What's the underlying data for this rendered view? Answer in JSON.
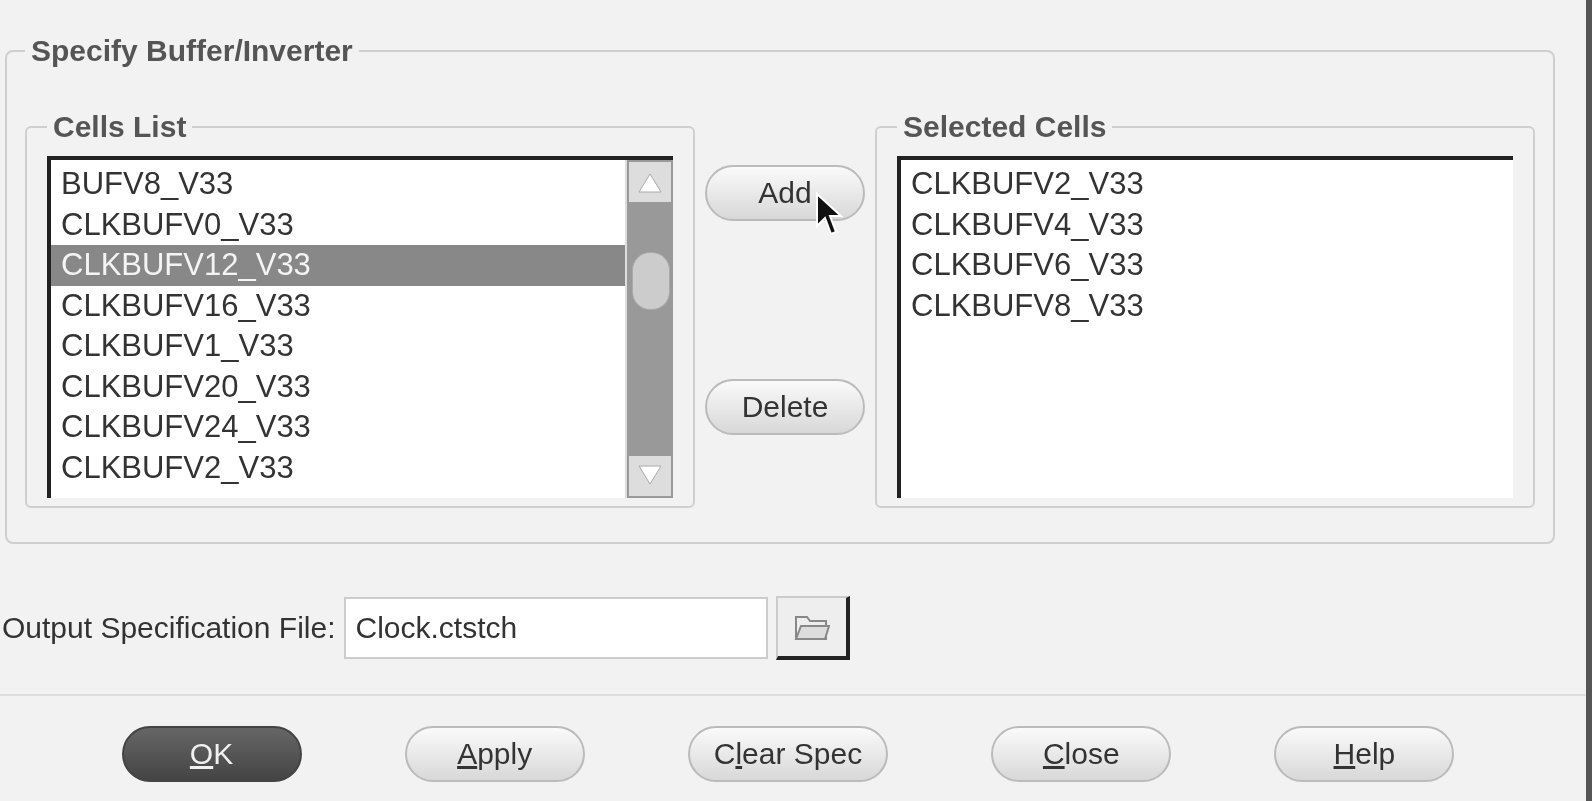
{
  "group": {
    "title": "Specify Buffer/Inverter",
    "cells_list": {
      "title": "Cells List",
      "items": [
        {
          "label": "BUFV8_V33",
          "selected": false
        },
        {
          "label": "CLKBUFV0_V33",
          "selected": false
        },
        {
          "label": "CLKBUFV12_V33",
          "selected": true
        },
        {
          "label": "CLKBUFV16_V33",
          "selected": false
        },
        {
          "label": "CLKBUFV1_V33",
          "selected": false
        },
        {
          "label": "CLKBUFV20_V33",
          "selected": false
        },
        {
          "label": "CLKBUFV24_V33",
          "selected": false
        },
        {
          "label": "CLKBUFV2_V33",
          "selected": false
        }
      ]
    },
    "actions": [
      "Add",
      "Delete"
    ],
    "selected_cells": {
      "title": "Selected Cells",
      "items": [
        {
          "label": "CLKBUFV2_V33",
          "selected": false
        },
        {
          "label": "CLKBUFV4_V33",
          "selected": false
        },
        {
          "label": "CLKBUFV6_V33",
          "selected": false
        },
        {
          "label": "CLKBUFV8_V33",
          "selected": false
        }
      ]
    }
  },
  "output": {
    "label": "Output Specification File:",
    "value": "Clock.ctstch"
  },
  "buttons": [
    {
      "mnemonic": "O",
      "after": "K",
      "default": true
    },
    {
      "mnemonic": "A",
      "after": "pply",
      "default": false
    },
    {
      "before": "C",
      "mnemonic": "l",
      "after": "ear Spec",
      "default": false
    },
    {
      "mnemonic": "C",
      "after": "lose",
      "default": false
    },
    {
      "mnemonic": "H",
      "after": "elp",
      "default": false
    }
  ]
}
